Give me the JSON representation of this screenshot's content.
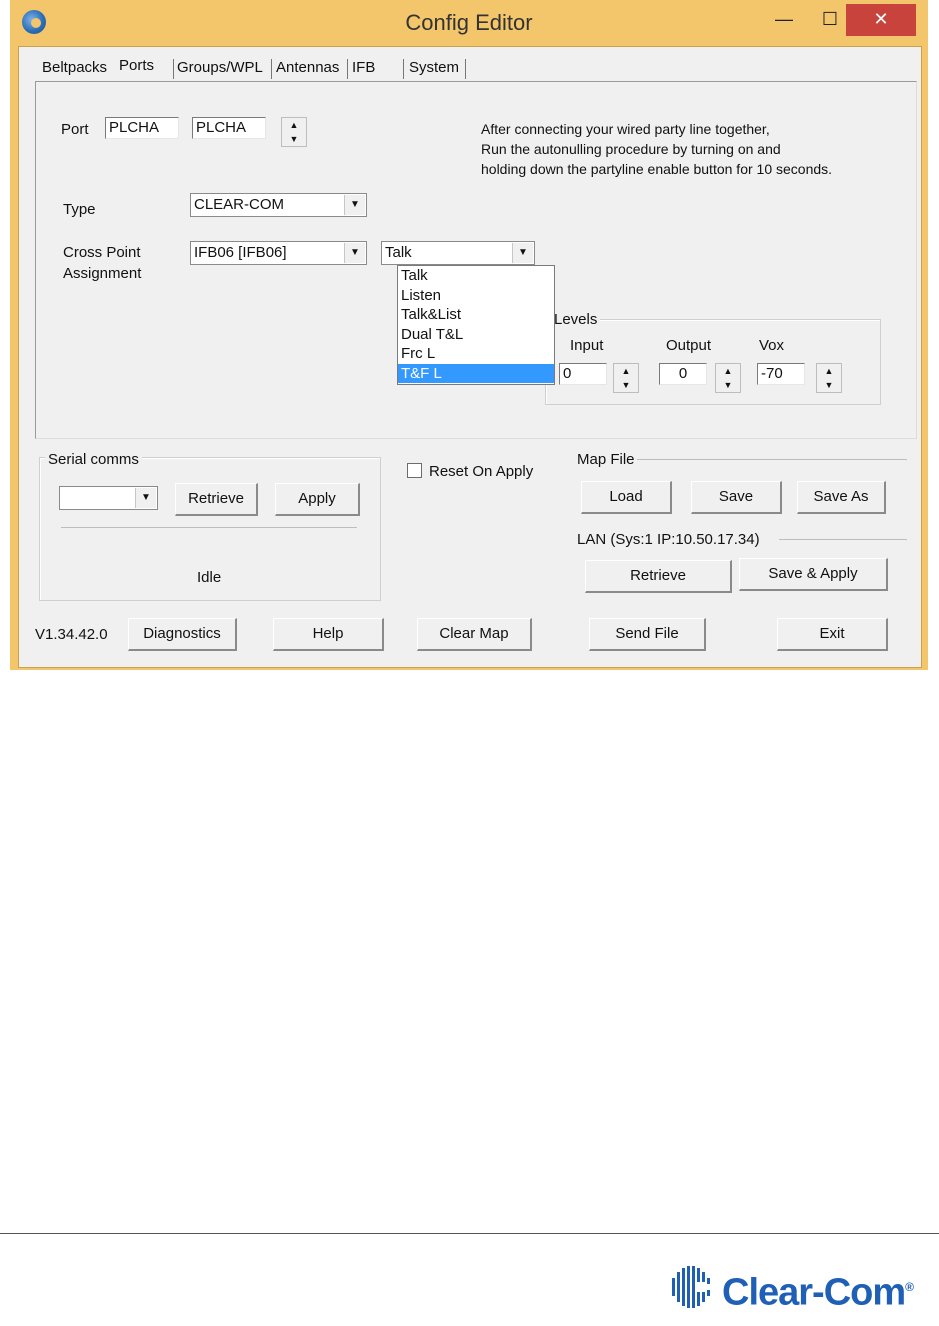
{
  "window": {
    "title": "Config Editor",
    "controls": {
      "minimize": "—",
      "maximize": "☐",
      "close": "✕"
    }
  },
  "tabs": [
    {
      "label": "Beltpacks"
    },
    {
      "label": "Ports"
    },
    {
      "label": "Groups/WPL"
    },
    {
      "label": "Antennas"
    },
    {
      "label": "IFB"
    },
    {
      "label": "System"
    }
  ],
  "port": {
    "label": "Port",
    "field1": "PLCHA",
    "field2": "PLCHA"
  },
  "info_text": {
    "line1": "After connecting your wired party line together,",
    "line2": "Run the autonulling procedure by turning on and",
    "line3": "holding down the partyline enable button for 10 seconds."
  },
  "type": {
    "label": "Type",
    "value": "CLEAR-COM"
  },
  "cross_point": {
    "label_line1": "Cross Point",
    "label_line2": "Assignment",
    "value": "IFB06  [IFB06]",
    "mode_value": "Talk",
    "mode_options": [
      "Talk",
      "Listen",
      "Talk&List",
      "Dual T&L",
      "Frc L",
      "T&F L"
    ],
    "mode_highlighted": "T&F L"
  },
  "levels": {
    "title": "Levels",
    "input_label": "Input",
    "input_value": "0",
    "output_label": "Output",
    "output_value": "0",
    "vox_label": "Vox",
    "vox_value": "-70"
  },
  "serial_comms": {
    "title": "Serial comms",
    "port_value": "",
    "retrieve_label": "Retrieve",
    "apply_label": "Apply",
    "status": "Idle"
  },
  "reset_on_apply": {
    "label": "Reset On Apply",
    "checked": false
  },
  "map_file": {
    "title": "Map File",
    "load_label": "Load",
    "save_label": "Save",
    "save_as_label": "Save As"
  },
  "lan": {
    "title": "LAN  (Sys:1 IP:10.50.17.34)",
    "retrieve_label": "Retrieve",
    "save_apply_label": "Save & Apply"
  },
  "bottom_bar": {
    "version": "V1.34.42.0",
    "diagnostics_label": "Diagnostics",
    "help_label": "Help",
    "clear_map_label": "Clear Map",
    "send_file_label": "Send File",
    "exit_label": "Exit"
  },
  "footer": {
    "logo_text": "Clear-Com",
    "logo_mark": "®",
    "brand_color": "#1f5fb5"
  }
}
